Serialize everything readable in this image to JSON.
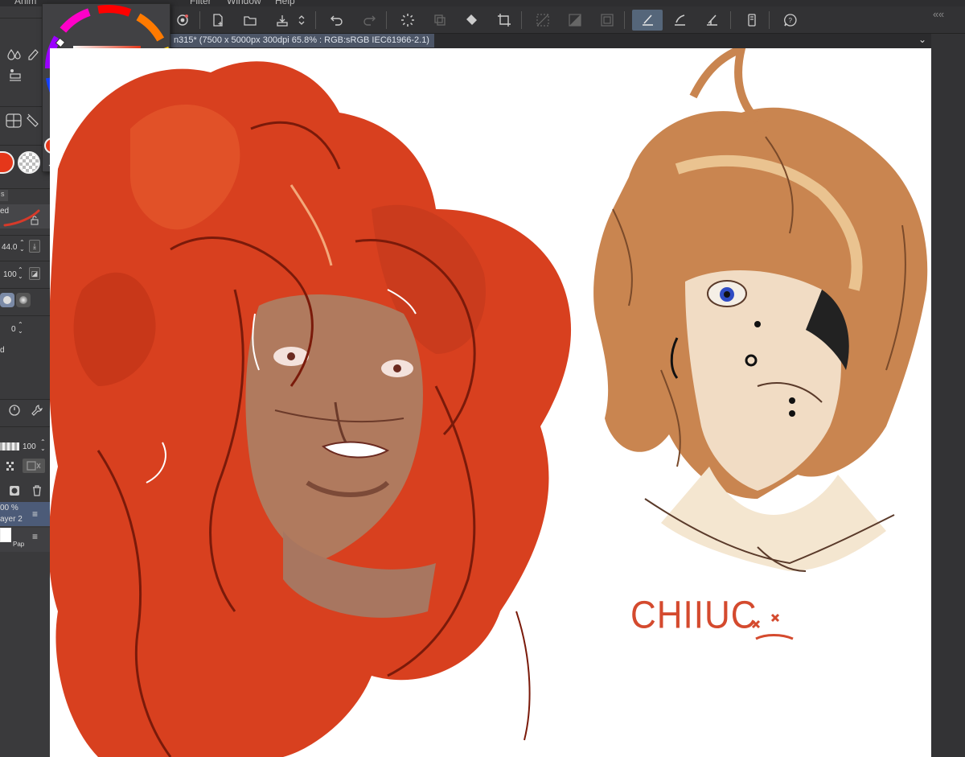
{
  "menu": {
    "items": [
      "Anim",
      "Filter",
      "Window",
      "Help"
    ]
  },
  "document": {
    "tab_label": "n315* (7500 x 5000px 300dpi 65.8% : RGB:sRGB IEC61966-2.1)"
  },
  "color_picker": {
    "r": "229",
    "g": "55",
    "b": "26"
  },
  "left_panel": {
    "blend_label": "ed",
    "brush_size": "44.0",
    "opacity": "100",
    "stabilization": "0",
    "anti_alias_label": "d",
    "layer_opacity": "100",
    "layer_row_opacity": "00 %",
    "layer_row_name": "ayer 2",
    "paper_label": "Pap"
  },
  "canvas": {
    "signature": "CHIIUC"
  },
  "colors": {
    "accent": "#e5371a",
    "hair_red": "#d8401f",
    "hair_brown": "#c98550"
  }
}
